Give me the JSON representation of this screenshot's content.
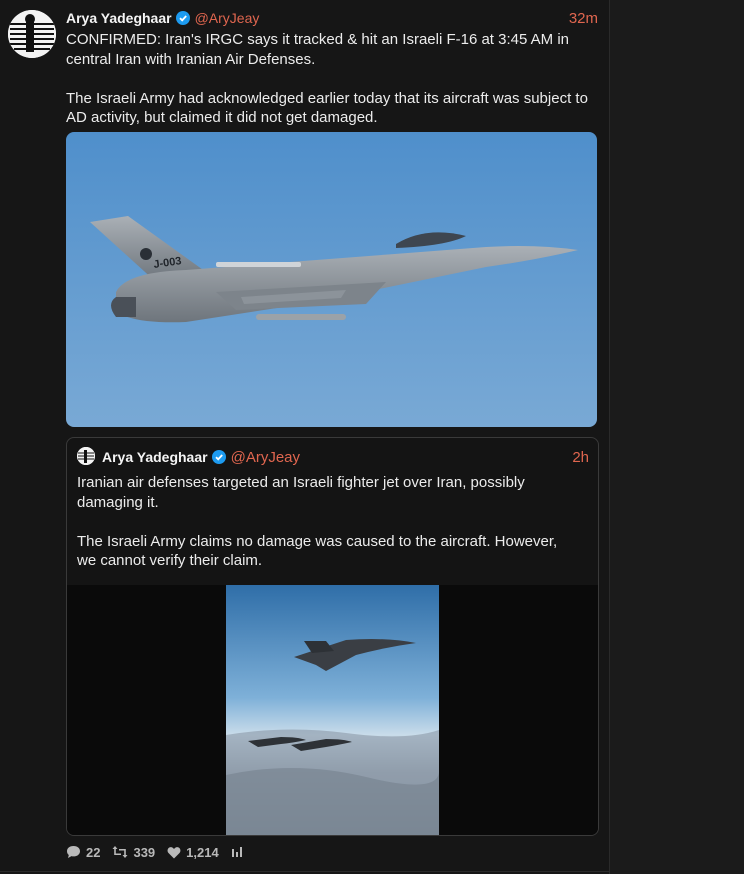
{
  "tweet": {
    "author_name": "Arya Yadeghaar",
    "handle": "@AryJeay",
    "time": "32m",
    "paragraphs": [
      "CONFIRMED: Iran's IRGC says it tracked & hit an Israeli F-16 at 3:45 AM in central Iran with Iranian Air Defenses.",
      "The Israeli Army had acknowledged earlier today that its aircraft was subject to AD activity, but claimed it did not get damaged."
    ],
    "image_tail_code": "J-003"
  },
  "quoted_tweet": {
    "author_name": "Arya Yadeghaar",
    "handle": "@AryJeay",
    "time": "2h",
    "paragraphs": [
      "Iranian air defenses targeted an Israeli fighter jet over Iran, possibly damaging it.",
      "The Israeli Army claims no damage was caused to the aircraft. However, we cannot verify their claim."
    ]
  },
  "actions": {
    "replies": "22",
    "retweets": "339",
    "likes": "1,214"
  },
  "colors": {
    "accent": "#e0664f",
    "verified": "#1d9bf0",
    "background": "#161616"
  },
  "icons": [
    "verified-badge-icon",
    "reply-icon",
    "retweet-icon",
    "like-icon",
    "analytics-icon"
  ]
}
